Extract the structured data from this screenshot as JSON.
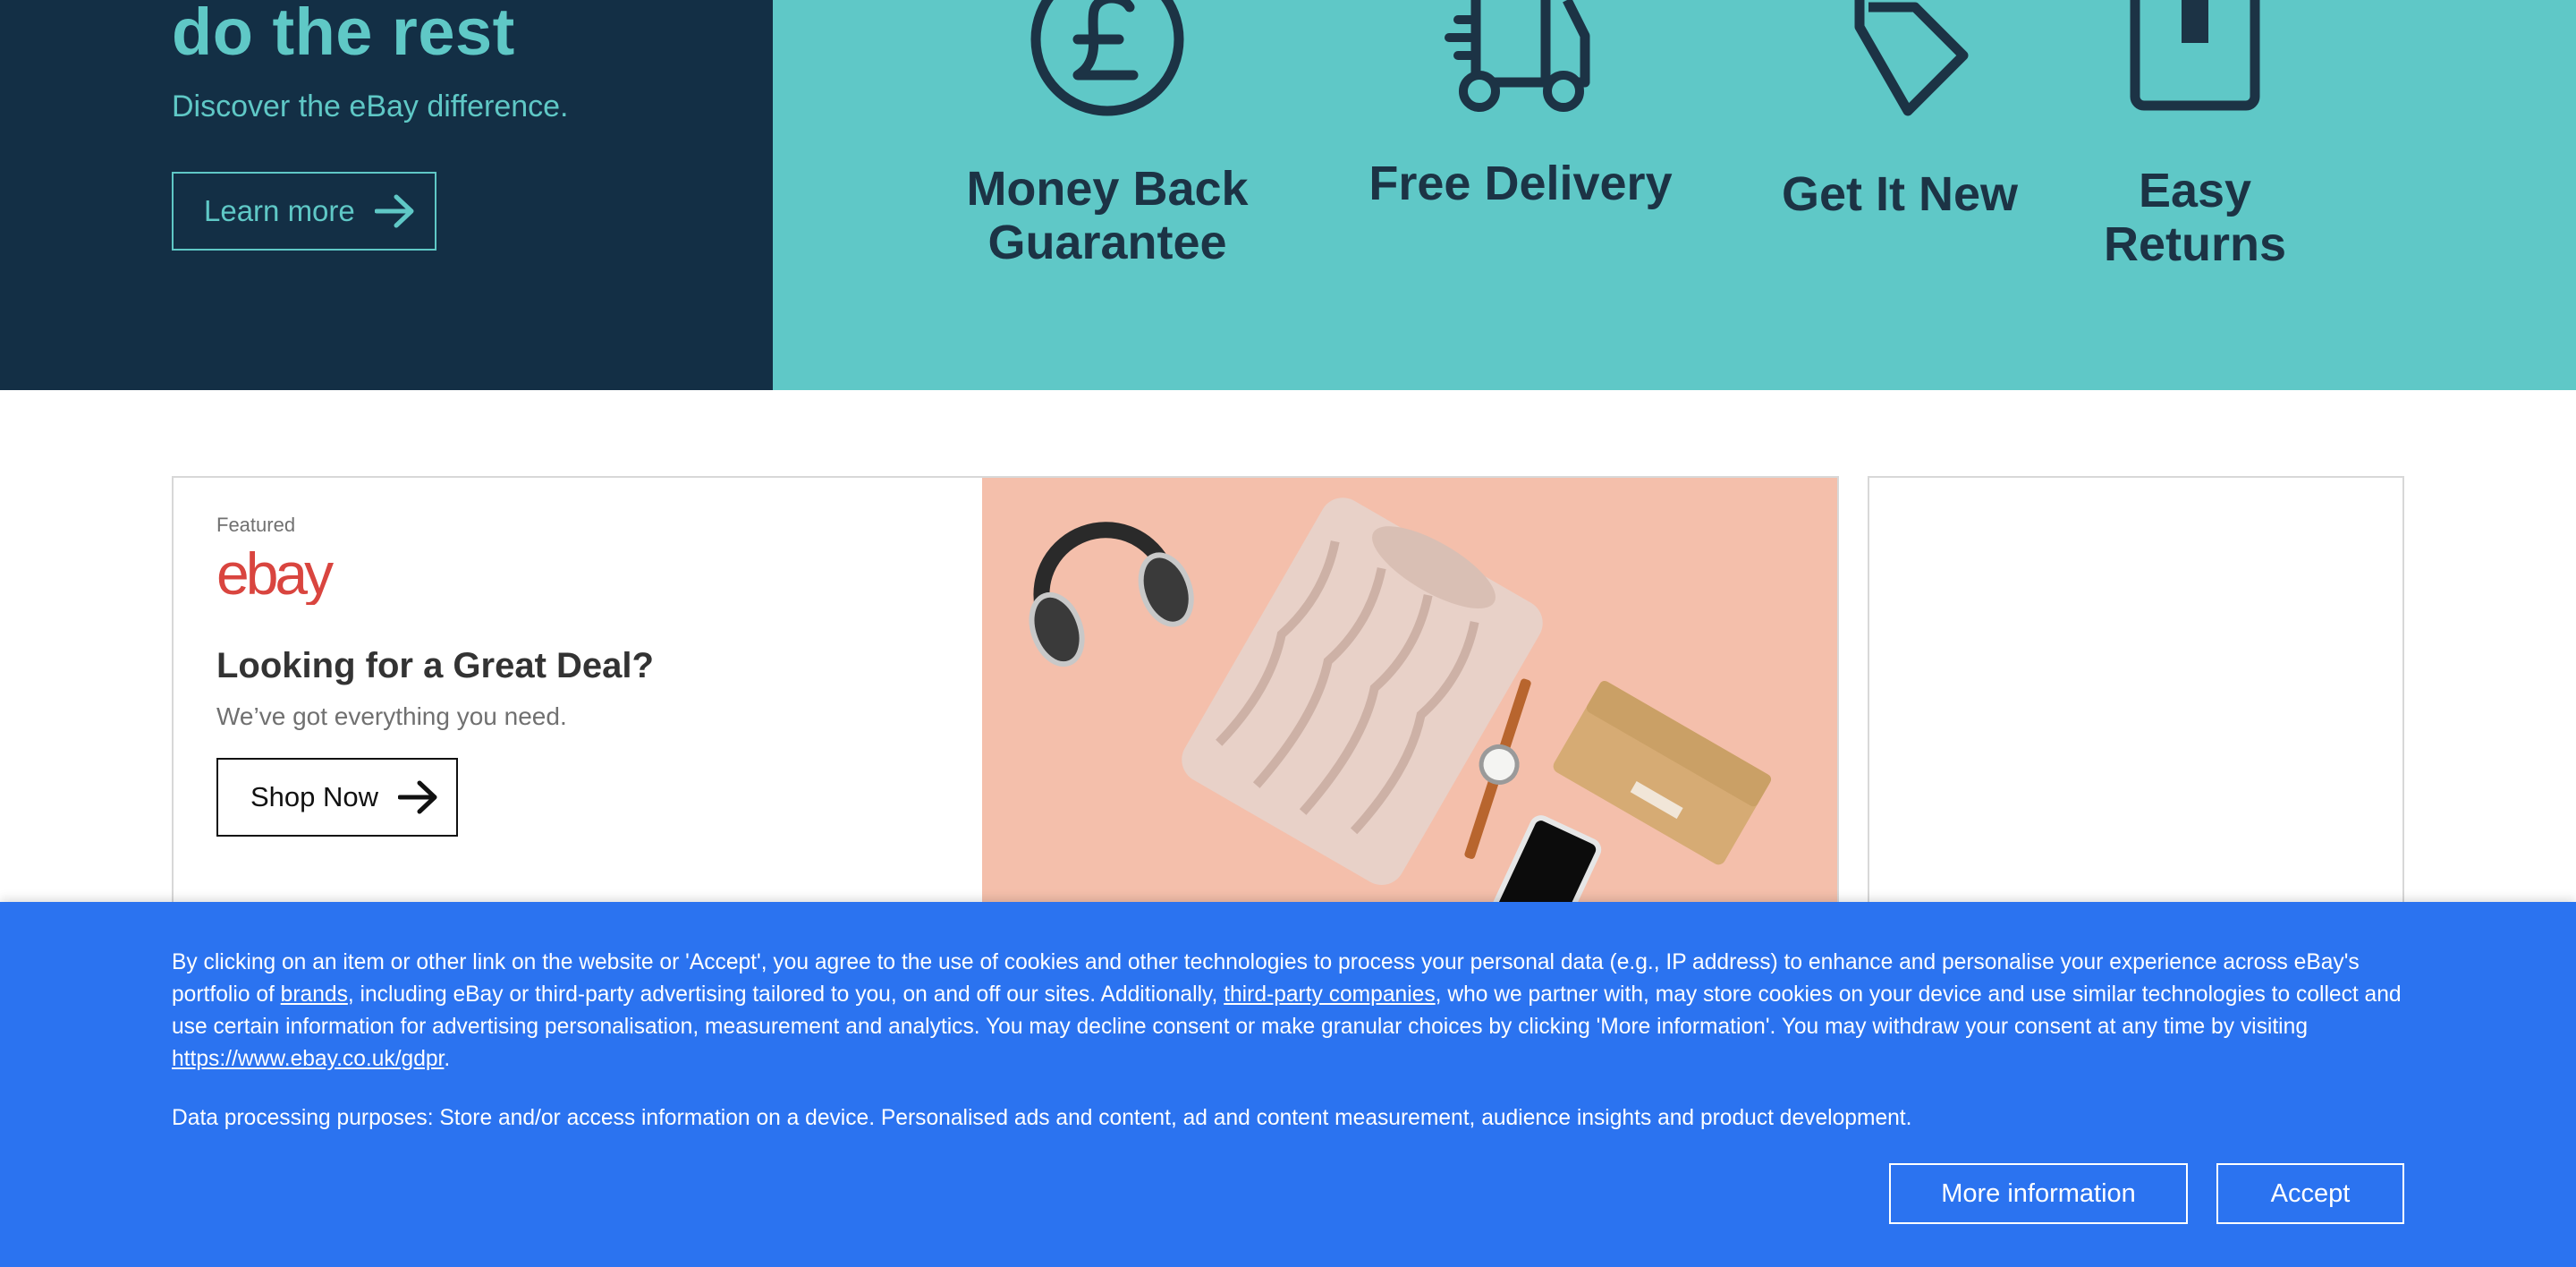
{
  "hero": {
    "headline": "do the rest",
    "subtitle": "Discover the eBay difference.",
    "cta_label": "Learn more",
    "features": [
      {
        "label": "Money Back Guarantee",
        "icon": "pound-circle-icon"
      },
      {
        "label": "Free Delivery",
        "icon": "delivery-truck-icon"
      },
      {
        "label": "Get It New",
        "icon": "price-tag-icon"
      },
      {
        "label": "Easy Returns",
        "icon": "return-box-icon"
      }
    ],
    "colors": {
      "dark": "#132f45",
      "teal": "#5fc8c7",
      "icon": "#1c3345"
    }
  },
  "featured": {
    "tag": "Featured",
    "logo_text": "ebay",
    "title": "Looking for a Great Deal?",
    "subtitle": "We’ve got everything you need.",
    "cta_label": "Shop Now",
    "image_alt": "headphones-sweater-watch-phone-wallet-image",
    "colors": {
      "image_bg": "#f4bfab",
      "logo": "#d9453f"
    }
  },
  "cookie_banner": {
    "text_part1": "By clicking on an item or other link on the website or 'Accept', you agree to the use of cookies and other technologies to process your personal data (e.g., IP address) to enhance and personalise your experience across eBay's portfolio of ",
    "brands_link": "brands",
    "text_part2": ", including eBay or third-party advertising tailored to you, on and off our sites. Additionally, ",
    "third_party_link": "third-party companies",
    "text_part3": ", who we partner with, may store cookies on your device and use similar technologies to collect and use certain information for advertising personalisation, measurement and analytics. You may decline consent or make granular choices by clicking 'More information'. You may withdraw your consent at any time by visiting ",
    "gdpr_link": "https://www.ebay.co.uk/gdpr",
    "text_part4": ".",
    "purposes": "Data processing purposes: Store and/or access information on a device. Personalised ads and content, ad and content measurement, audience insights and product development.",
    "more_info_label": "More information",
    "accept_label": "Accept",
    "colors": {
      "background": "#2b73f0"
    }
  }
}
